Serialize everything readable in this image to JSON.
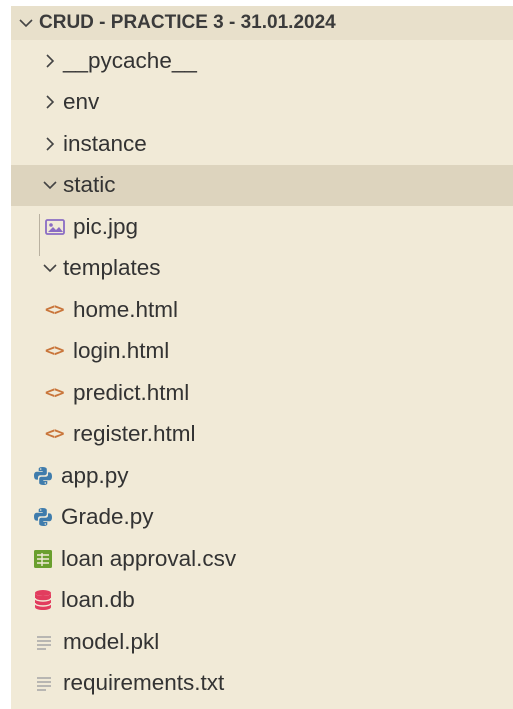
{
  "explorer": {
    "title": "CRUD - PRACTICE 3 - 31.01.2024",
    "items": [
      {
        "label": "__pycache__",
        "kind": "folder",
        "expanded": false
      },
      {
        "label": "env",
        "kind": "folder",
        "expanded": false
      },
      {
        "label": "instance",
        "kind": "folder",
        "expanded": false
      },
      {
        "label": "static",
        "kind": "folder",
        "expanded": true,
        "selected": true
      },
      {
        "label": "pic.jpg",
        "kind": "image-file"
      },
      {
        "label": "templates",
        "kind": "folder",
        "expanded": true
      },
      {
        "label": "home.html",
        "kind": "html-file"
      },
      {
        "label": "login.html",
        "kind": "html-file"
      },
      {
        "label": "predict.html",
        "kind": "html-file"
      },
      {
        "label": "register.html",
        "kind": "html-file"
      },
      {
        "label": "app.py",
        "kind": "python-file"
      },
      {
        "label": "Grade.py",
        "kind": "python-file"
      },
      {
        "label": "loan approval.csv",
        "kind": "csv-file"
      },
      {
        "label": "loan.db",
        "kind": "database-file"
      },
      {
        "label": "model.pkl",
        "kind": "text-file"
      },
      {
        "label": "requirements.txt",
        "kind": "text-file"
      }
    ]
  },
  "colors": {
    "background": "#f1ead7",
    "header": "#e8e0cb",
    "selected_row": "#ddd4be",
    "text": "#333333",
    "html_icon": "#c9753a",
    "python_icon_blue": "#3f7cac",
    "csv_icon": "#6a9f2e",
    "db_icon": "#e23c5e",
    "image_icon": "#8a6cc4",
    "text_icon": "#9a9a9a"
  }
}
